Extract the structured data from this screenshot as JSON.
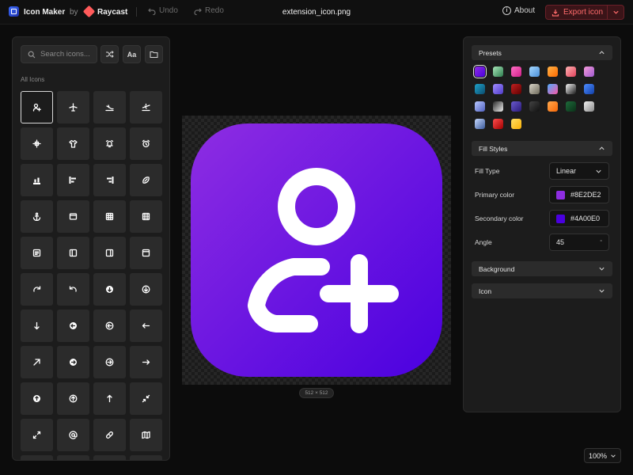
{
  "topbar": {
    "app_name": "Icon Maker",
    "by": "by",
    "brand": "Raycast",
    "undo": "Undo",
    "redo": "Redo",
    "file_name": "extension_icon.png",
    "about": "About",
    "export": "Export icon"
  },
  "left_panel": {
    "search_placeholder": "Search icons...",
    "font_toggle": "Aa",
    "section_label": "All Icons",
    "selected_icon": "add-person-icon",
    "icons": [
      "add-person-icon",
      "airplane-icon",
      "airplane-landing-icon",
      "airplane-takeoff-icon",
      "crosshair-plus-icon",
      "shirt-icon",
      "alarm-icon",
      "alarm-clock-icon",
      "align-bottom-icon",
      "align-left-icon",
      "align-right-icon",
      "football-icon",
      "anchor-icon",
      "window-icon",
      "grid-icon",
      "grid-dense-icon",
      "document-icon",
      "sidebar-left-icon",
      "sidebar-right-icon",
      "browser-icon",
      "redo-arrow-icon",
      "undo-arrow-icon",
      "arrow-down-circle-filled-icon",
      "arrow-down-circle-icon",
      "arrow-down-icon",
      "arrow-left-circle-filled-icon",
      "arrow-left-circle-icon",
      "arrow-left-icon",
      "arrow-up-right-icon",
      "arrow-right-circle-filled-icon",
      "arrow-right-circle-icon",
      "arrow-right-icon",
      "arrow-up-circle-filled-icon",
      "arrow-up-circle-icon",
      "arrow-up-icon",
      "minimize-icon",
      "maximize-icon",
      "at-sign-icon",
      "bandage-icon",
      "map-icon",
      "placeholder-icon",
      "placeholder-icon",
      "placeholder-icon",
      "placeholder-icon"
    ]
  },
  "canvas": {
    "size_label": "512 × 512",
    "icon": "add-person-icon",
    "gradient_start": "#8E2DE2",
    "gradient_end": "#4A00E0",
    "foreground": "#FFFFFF"
  },
  "right_panel": {
    "presets_title": "Presets",
    "presets": [
      {
        "from": "#8E2DE2",
        "to": "#4A00E0"
      },
      {
        "from": "#a8e6b8",
        "to": "#2e7d4f"
      },
      {
        "from": "#ff6ec4",
        "to": "#d0208a"
      },
      {
        "from": "#a6d8ff",
        "to": "#4a90d9"
      },
      {
        "from": "#ffb347",
        "to": "#ff6a00"
      },
      {
        "from": "#ffb3b3",
        "to": "#e0405a"
      },
      {
        "from": "#f39ad8",
        "to": "#a05ad0"
      },
      {
        "from": "#1fa2c9",
        "to": "#0b4c6e"
      },
      {
        "from": "#a18cff",
        "to": "#4f3cc9"
      },
      {
        "from": "#c02020",
        "to": "#600000"
      },
      {
        "from": "#d8d4c8",
        "to": "#6e6a5a"
      },
      {
        "from": "#4facfe",
        "to": "#f857a6"
      },
      {
        "from": "#f5f5f5",
        "to": "#1a1a1a"
      },
      {
        "from": "#4d8cff",
        "to": "#1240a8"
      },
      {
        "from": "#b8c8ff",
        "to": "#5060c0"
      },
      {
        "from": "#2a2a2a",
        "to": "#f0f0f0"
      },
      {
        "from": "#6a5acd",
        "to": "#2a1a7a"
      },
      {
        "from": "#444444",
        "to": "#111111"
      },
      {
        "from": "#ffa94d",
        "to": "#f76707"
      },
      {
        "from": "#1e6b3a",
        "to": "#0a3018"
      },
      {
        "from": "#f2f2f2",
        "to": "#8a8a8a"
      },
      {
        "from": "#c6d8ff",
        "to": "#3a5a9a"
      },
      {
        "from": "#ff4d4d",
        "to": "#a00000"
      },
      {
        "from": "#ffe066",
        "to": "#fab005"
      }
    ],
    "fill_title": "Fill Styles",
    "fill_type_label": "Fill Type",
    "fill_type_value": "Linear",
    "primary_label": "Primary color",
    "primary_value": "#8E2DE2",
    "secondary_label": "Secondary color",
    "secondary_value": "#4A00E0",
    "angle_label": "Angle",
    "angle_value": "45",
    "angle_unit": "°",
    "background_title": "Background",
    "icon_title": "Icon"
  },
  "zoom": {
    "value": "100%"
  }
}
